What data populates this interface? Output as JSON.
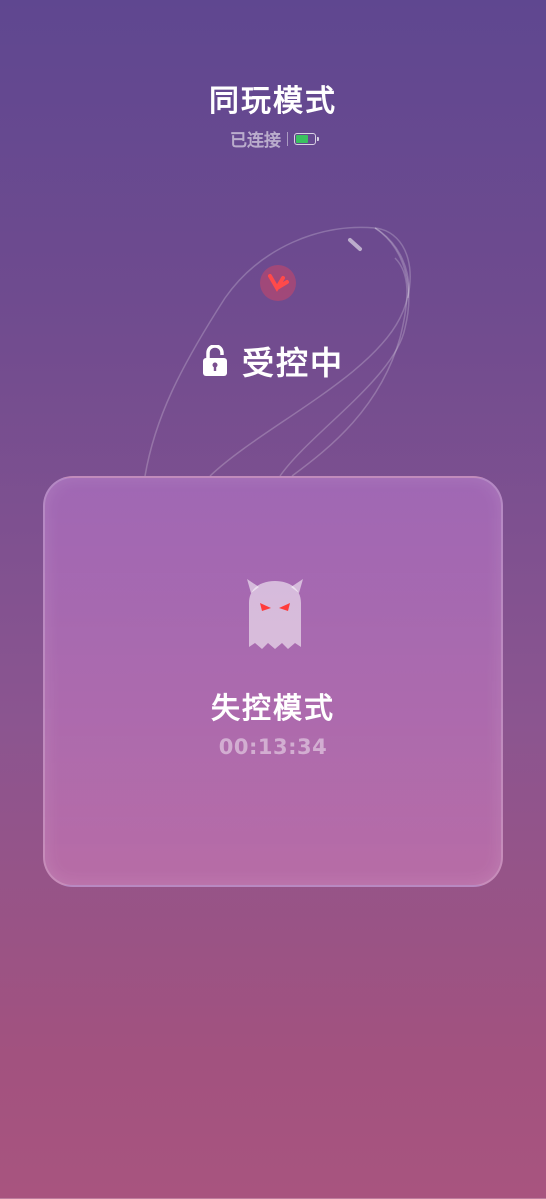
{
  "header": {
    "title": "同玩模式",
    "connection_status": "已连接",
    "battery_icon": "battery-icon",
    "battery_level": 0.7,
    "battery_color": "#3ac160"
  },
  "device": {
    "icon": "device-outline-illustration",
    "indicator_color": "#ff4a4a"
  },
  "lock_status": {
    "icon": "lock-open-icon",
    "label": "受控中"
  },
  "mode_card": {
    "icon": "ghost-devil-icon",
    "mode_label": "失控模式",
    "timer": "00:13:34"
  }
}
